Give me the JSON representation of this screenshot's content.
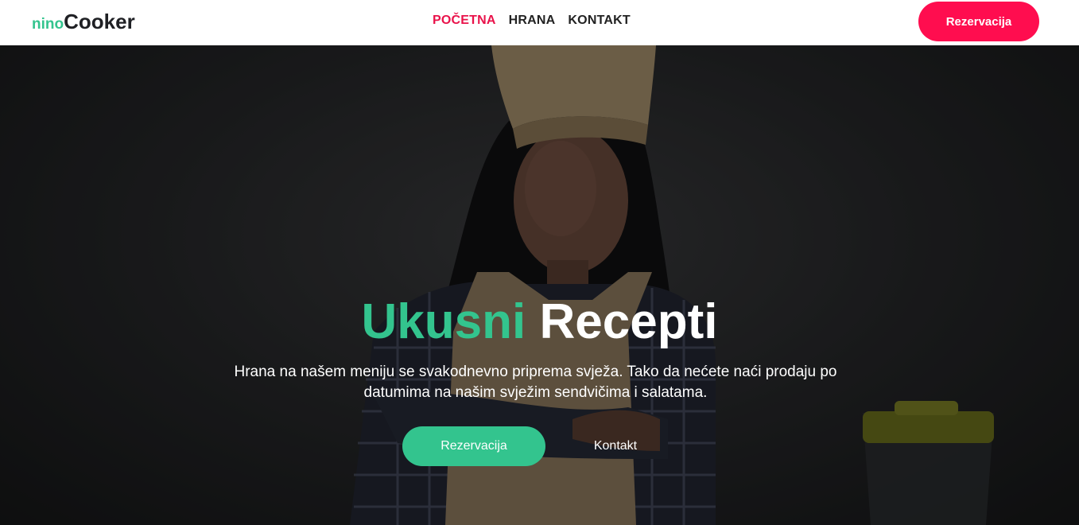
{
  "brand": {
    "part1": "nino",
    "part2": "Cooker"
  },
  "nav": {
    "items": [
      {
        "label": "POČETNA",
        "active": true
      },
      {
        "label": "HRANA",
        "active": false
      },
      {
        "label": "KONTAKT",
        "active": false
      }
    ],
    "cta_label": "Rezervacija"
  },
  "hero": {
    "title_green": "Ukusni",
    "title_white": "Recepti",
    "text": "Hrana na našem meniju se svakodnevno priprema svježa. Tako da nećete naći prodaju po datumima na našim svježim sendvičima i salatama.",
    "primary_button": "Rezervacija",
    "secondary_button": "Kontakt",
    "image_icon": "chef-woman-photo"
  },
  "colors": {
    "accent_green": "#33c48e",
    "accent_red": "#ff0d4f",
    "nav_active": "#e9124a"
  }
}
